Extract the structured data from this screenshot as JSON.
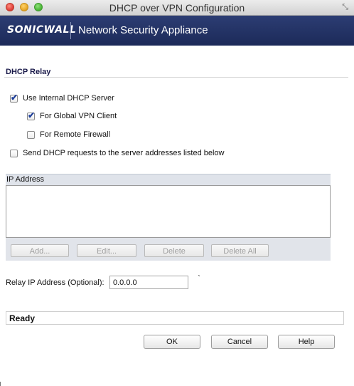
{
  "window": {
    "title": "DHCP over VPN Configuration"
  },
  "banner": {
    "logo": "SONICWALL",
    "product": "Network Security Appliance"
  },
  "section": {
    "title": "DHCP Relay"
  },
  "options": {
    "use_internal": {
      "label": "Use Internal DHCP Server",
      "checked": true
    },
    "global_vpn": {
      "label": "For Global VPN Client",
      "checked": true
    },
    "remote_firewall": {
      "label": "For Remote Firewall",
      "checked": false
    },
    "send_requests": {
      "label": "Send DHCP requests to the server addresses listed below",
      "checked": false
    }
  },
  "ip_table": {
    "column": "IP Address",
    "rows": []
  },
  "ip_buttons": {
    "add": "Add...",
    "edit": "Edit...",
    "delete": "Delete",
    "delete_all": "Delete All"
  },
  "relay": {
    "label": "Relay IP Address (Optional):",
    "value": "0.0.0.0"
  },
  "status": {
    "text": "Ready"
  },
  "footer": {
    "ok": "OK",
    "cancel": "Cancel",
    "help": "Help"
  },
  "colors": {
    "banner": "#1c2a59",
    "checkmark": "#1e3f9a"
  }
}
